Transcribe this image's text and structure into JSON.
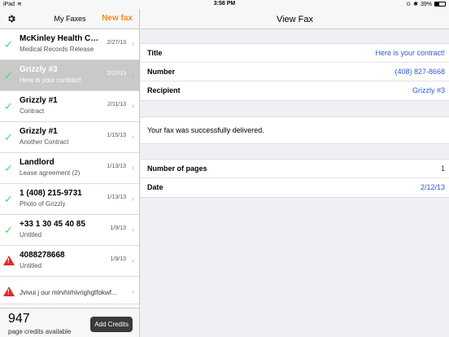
{
  "status_bar": {
    "device": "iPad",
    "time": "3:58 PM",
    "battery": "39%"
  },
  "left_panel": {
    "title": "My Faxes",
    "new_fax_label": "New fax",
    "items": [
      {
        "title": "McKinley Health Ce...",
        "subtitle": "Medical Records Release",
        "date": "2/27/13",
        "status": "sent"
      },
      {
        "title": "Grizzly #3",
        "subtitle": "Here is your contract!",
        "date": "2/12/13",
        "status": "sent",
        "selected": true
      },
      {
        "title": "Grizzly #1",
        "subtitle": "Contract",
        "date": "2/11/13",
        "status": "sent"
      },
      {
        "title": "Grizzly #1",
        "subtitle": "Another Contract",
        "date": "1/15/13",
        "status": "sent"
      },
      {
        "title": "Landlord",
        "subtitle": "Lease agreement (2)",
        "date": "1/13/13",
        "status": "sent"
      },
      {
        "title": "1 (408) 215-9731",
        "subtitle": "Photo of Grizzly",
        "date": "1/13/13",
        "status": "sent"
      },
      {
        "title": "+33 1 30 45 40 85",
        "subtitle": "Untitled",
        "date": "1/9/13",
        "status": "sent"
      },
      {
        "title": "4088278668",
        "subtitle": "Untitled",
        "date": "1/9/13",
        "status": "failed"
      },
      {
        "title": "",
        "subtitle": "Jvivui j our mirvhirhivrighgtfokwf...",
        "date": "",
        "status": "failed"
      }
    ],
    "credits_count": "947",
    "credits_label": "page credits available",
    "add_credits_label": "Add Credits"
  },
  "right_panel": {
    "title": "View Fax",
    "details": [
      {
        "label": "Title",
        "value": "Here is your contract!"
      },
      {
        "label": "Number",
        "value": "(408) 827-8668"
      },
      {
        "label": "Recipient",
        "value": "Grizzly #3"
      }
    ],
    "message": "Your fax was successfully delivered.",
    "meta": [
      {
        "label": "Number of pages",
        "value": "1"
      },
      {
        "label": "Date",
        "value": "2/12/13"
      }
    ]
  },
  "colors": {
    "accent": "#f08a24",
    "link": "#2b5bd7",
    "success": "#4cd964",
    "error": "#e32b2b"
  }
}
